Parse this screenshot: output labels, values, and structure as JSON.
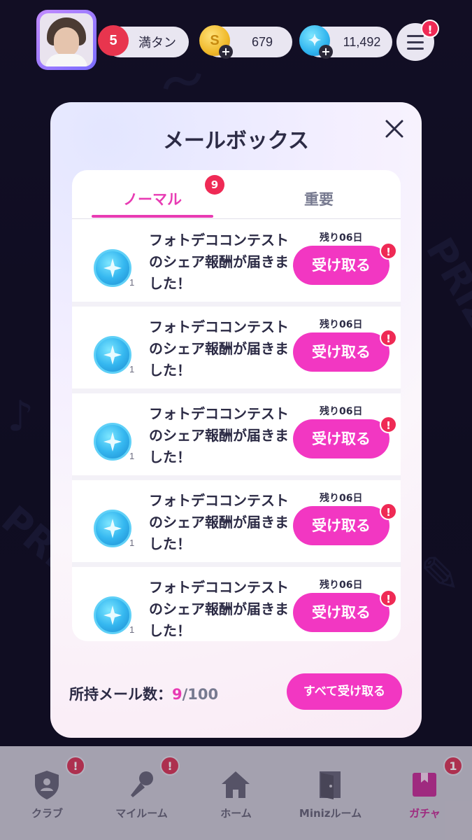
{
  "topbar": {
    "hearts": {
      "count": "5",
      "status": "満タン"
    },
    "gold": {
      "value": "679"
    },
    "gems": {
      "value": "11,492"
    },
    "menu_badge": "!"
  },
  "mailbox": {
    "title": "メールボックス",
    "tabs": [
      {
        "label": "ノーマル",
        "badge": "9",
        "active": true
      },
      {
        "label": "重要",
        "active": false
      }
    ],
    "mails": [
      {
        "text": "フォトデココンテストのシェア報酬が届きました！",
        "reward_icon": "gem-coin-icon",
        "quantity": "1",
        "remaining": "残り06日",
        "button": "受け取る",
        "badge": "!"
      },
      {
        "text": "フォトデココンテストのシェア報酬が届きました！",
        "reward_icon": "gem-coin-icon",
        "quantity": "1",
        "remaining": "残り06日",
        "button": "受け取る",
        "badge": "!"
      },
      {
        "text": "フォトデココンテストのシェア報酬が届きました！",
        "reward_icon": "gem-coin-icon",
        "quantity": "1",
        "remaining": "残り06日",
        "button": "受け取る",
        "badge": "!"
      },
      {
        "text": "フォトデココンテストのシェア報酬が届きました！",
        "reward_icon": "gem-coin-icon",
        "quantity": "1",
        "remaining": "残り06日",
        "button": "受け取る",
        "badge": "!"
      },
      {
        "text": "フォトデココンテストのシェア報酬が届きました！",
        "reward_icon": "gem-coin-icon",
        "quantity": "1",
        "remaining": "残り06日",
        "button": "受け取る",
        "badge": "!"
      }
    ],
    "footer": {
      "label": "所持メール数：",
      "current": "9",
      "max": "/100",
      "claim_all": "すべて受け取る"
    }
  },
  "bottom_nav": [
    {
      "label": "クラブ",
      "icon": "shield-user-icon",
      "badge": "!"
    },
    {
      "label": "マイルーム",
      "icon": "microphone-icon",
      "badge": "!"
    },
    {
      "label": "ホーム",
      "icon": "home-icon",
      "badge": ""
    },
    {
      "label": "Minizルーム",
      "icon": "door-icon",
      "badge": ""
    },
    {
      "label": "ガチャ",
      "icon": "gacha-box-icon",
      "badge": "1",
      "active": true
    }
  ],
  "colors": {
    "accent": "#f237c2",
    "badge": "#ef2a55",
    "text_dark": "#2c2b45",
    "tab_inactive": "#777a90"
  }
}
